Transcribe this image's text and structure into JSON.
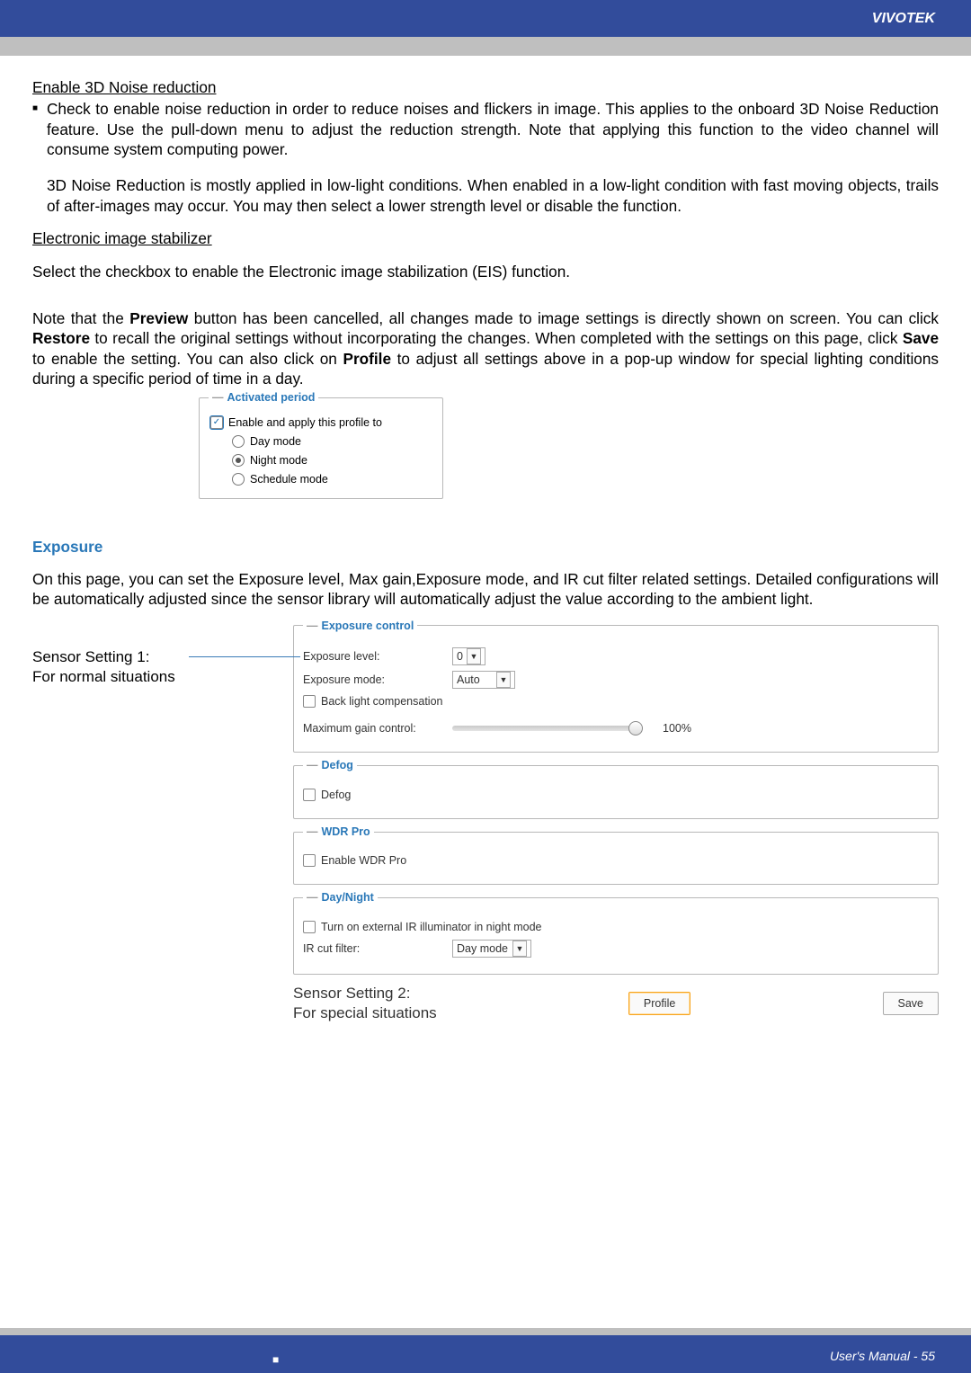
{
  "header": {
    "brand": "VIVOTEK"
  },
  "footer": {
    "text": "User's Manual - 55",
    "bullet": "■"
  },
  "section1": {
    "title": "Enable 3D Noise reduction",
    "bullet1_part1": "Check to enable noise reduction in order to reduce noises and flickers in image. This applies to the onboard 3D Noise Reduction feature. Use the pull-down menu to adjust the reduction strength. Note that applying this function to the video channel will consume system computing power.",
    "bullet1_part2": "3D Noise Reduction is mostly applied in low-light conditions. When enabled in a low-light condition with fast moving objects, trails of after-images may occur. You may then select a lower strength level or disable the function."
  },
  "section2": {
    "title": "Electronic image stabilizer",
    "body": "Select the checkbox to enable the Electronic image stabilization (EIS) function."
  },
  "section3": {
    "prefix": "Note that the ",
    "w_preview": "Preview",
    "mid1": " button has been cancelled, all changes made to image settings is directly shown on screen. You can click ",
    "w_restore": "Restore",
    "mid2": " to recall the original settings without incorporating the changes. When completed with the settings on this page, click ",
    "w_save": "Save",
    "mid3": " to enable the setting. You can also click on ",
    "w_profile": "Profile",
    "mid4": " to adjust all settings above in a pop-up window for special lighting conditions during a specific period of time in a day."
  },
  "activated_period": {
    "legend": "Activated period",
    "enable_label": "Enable and apply this profile to",
    "modes": [
      "Day mode",
      "Night mode",
      "Schedule mode"
    ],
    "selected": "Night mode"
  },
  "exposure_section": {
    "title": "Exposure",
    "body": "On this page, you can set the Exposure level, Max gain,Exposure mode, and IR cut filter related settings. Detailed configurations will be automatically adjusted since the sensor library will automatically adjust the value according to the ambient light."
  },
  "left_note": {
    "line1": "Sensor Setting 1:",
    "line2": "For normal situations"
  },
  "panel": {
    "exposure_control": {
      "legend": "Exposure control",
      "level_label": "Exposure level:",
      "level_value": "0",
      "mode_label": "Exposure mode:",
      "mode_value": "Auto",
      "blc_label": "Back light compensation",
      "max_gain_label": "Maximum gain control:",
      "max_gain_value": "100%"
    },
    "defog": {
      "legend": "Defog",
      "chk_label": "Defog"
    },
    "wdr": {
      "legend": "WDR Pro",
      "chk_label": "Enable WDR Pro"
    },
    "daynight": {
      "legend": "Day/Night",
      "ir_label": "Turn on external IR illuminator in night mode",
      "ircut_label": "IR cut filter:",
      "ircut_value": "Day mode"
    },
    "bottom": {
      "s2l1": "Sensor Setting 2:",
      "s2l2": "For special situations",
      "profile_btn": "Profile",
      "save_btn": "Save"
    }
  }
}
